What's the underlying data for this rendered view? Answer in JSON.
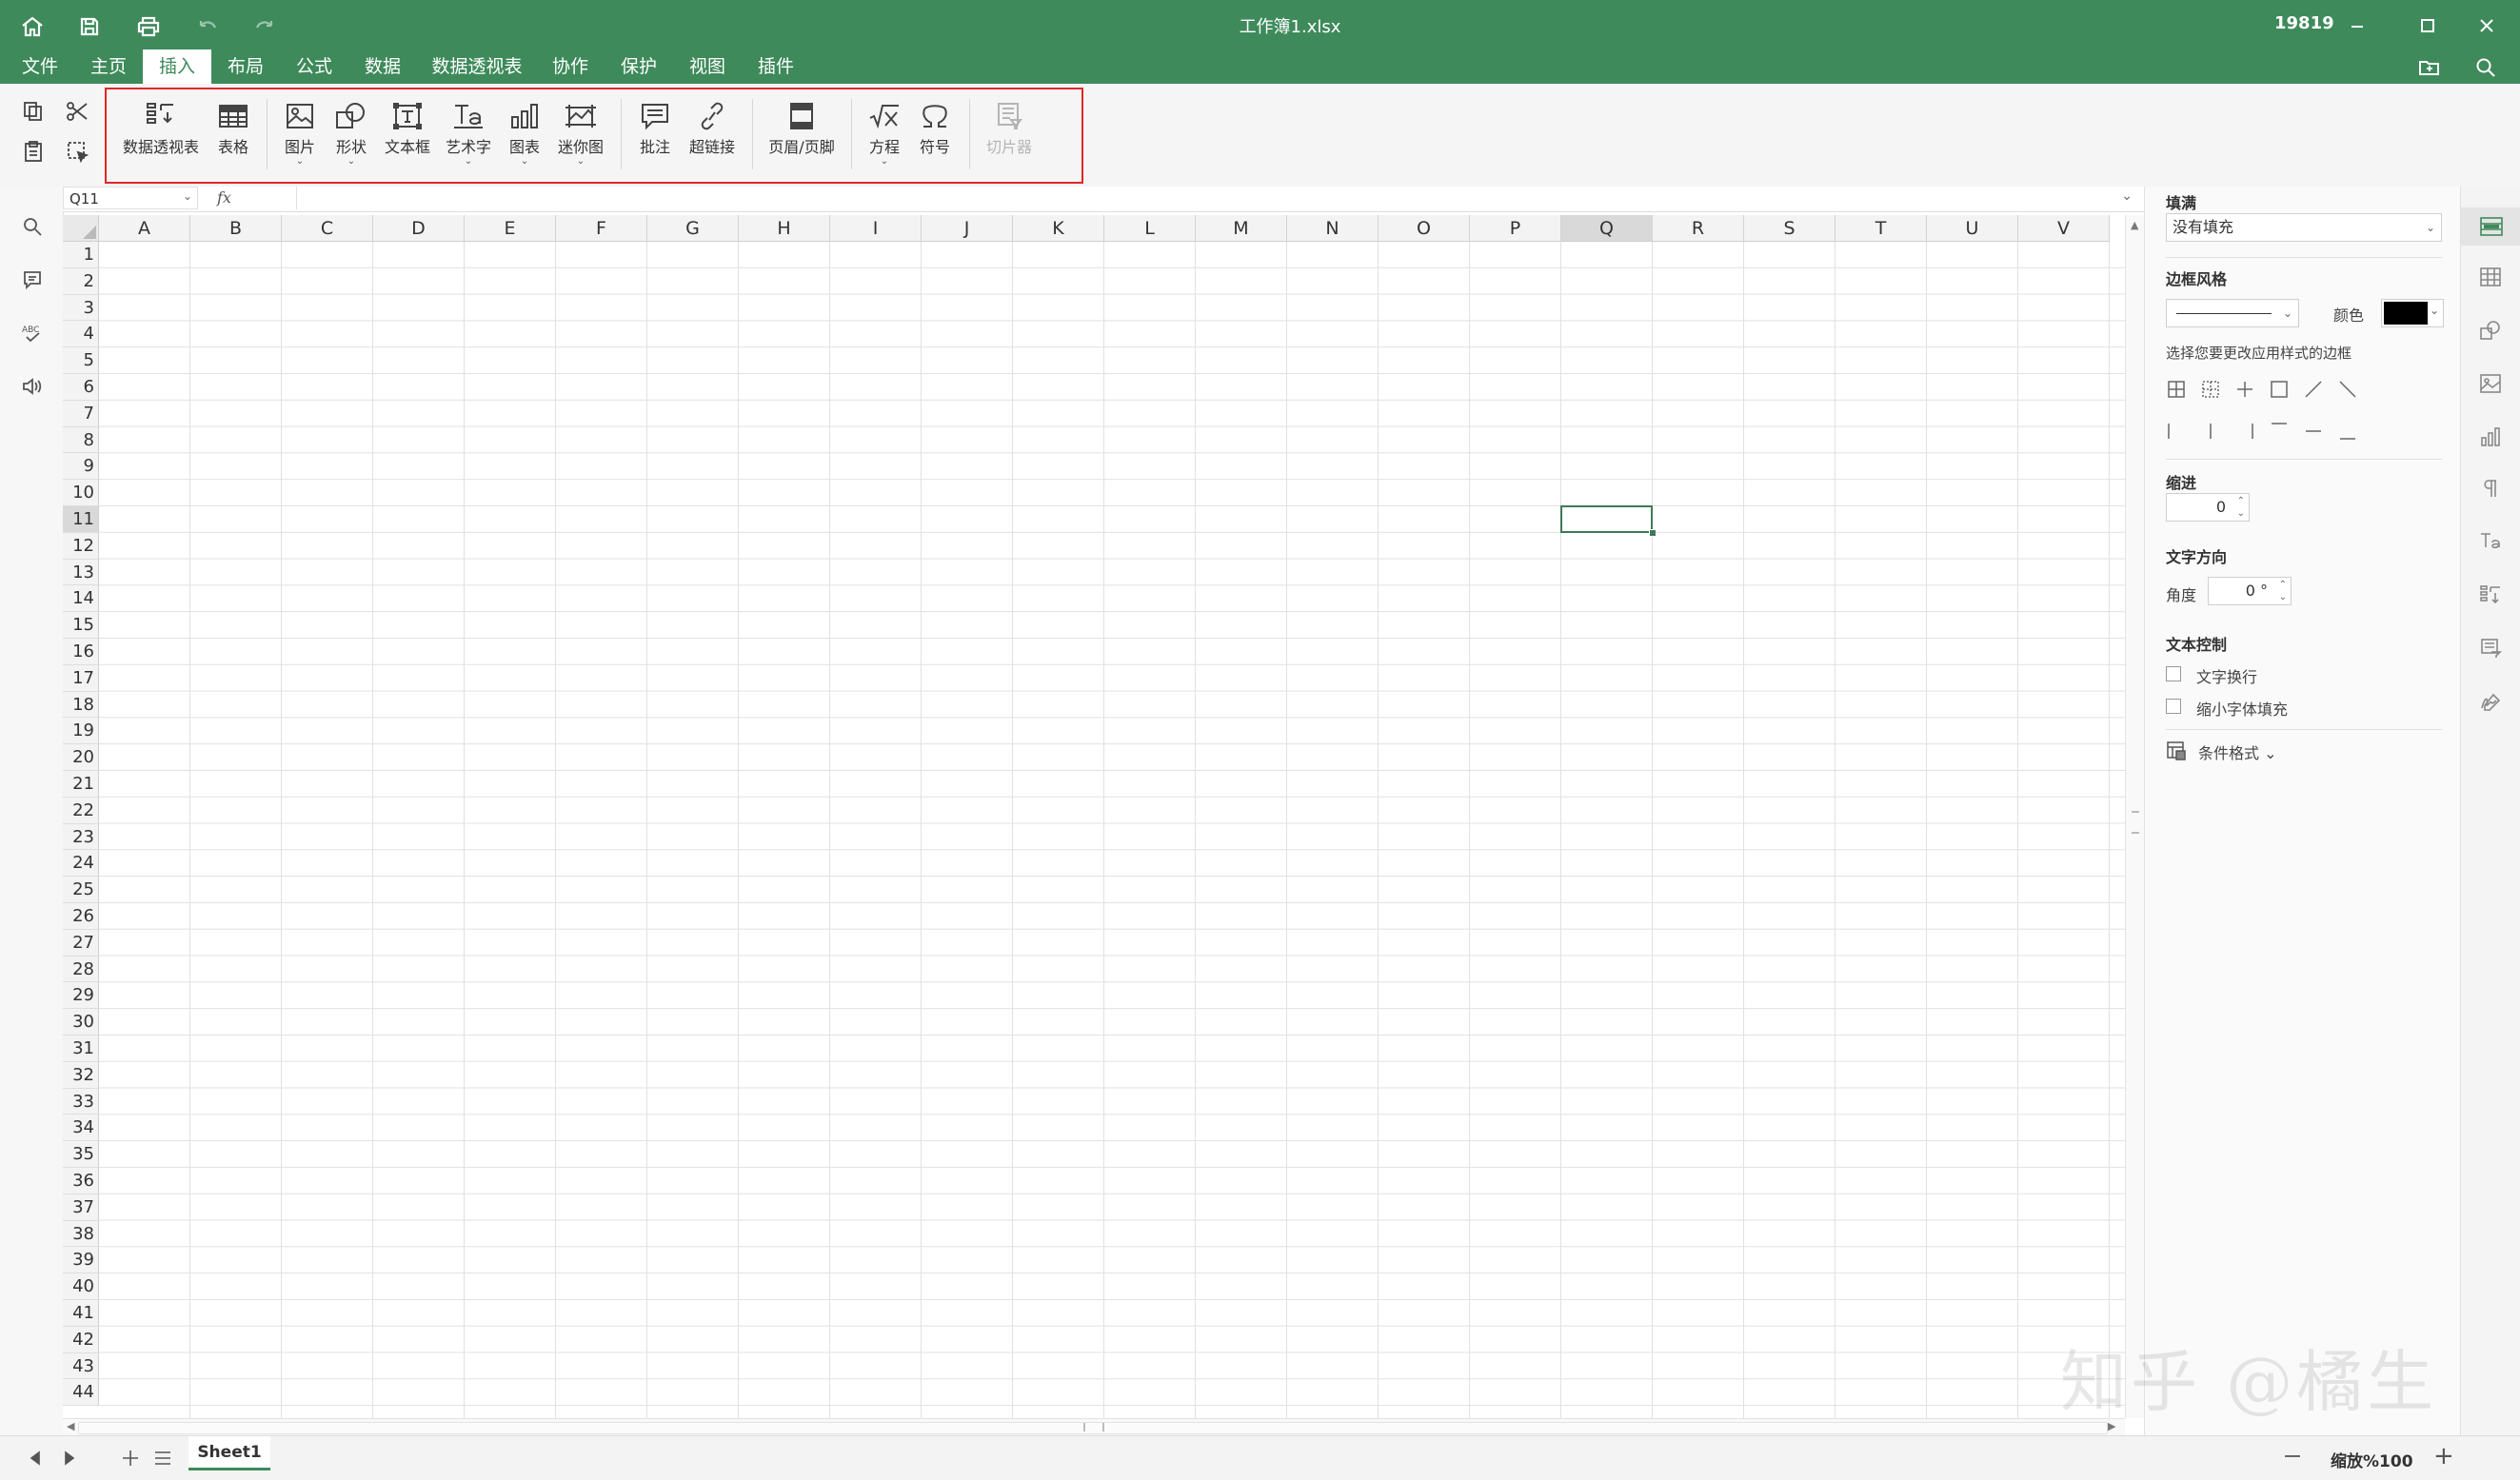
{
  "window": {
    "title": "工作簿1.xlsx",
    "user_id": "19819"
  },
  "menu": {
    "tabs": [
      "文件",
      "主页",
      "插入",
      "布局",
      "公式",
      "数据",
      "数据透视表",
      "协作",
      "保护",
      "视图",
      "插件"
    ],
    "active": "插入"
  },
  "ribbon": {
    "buttons": [
      {
        "label": "数据透视表",
        "icon": "pivot-table-icon",
        "caret": false,
        "disabled": false
      },
      {
        "label": "表格",
        "icon": "table-icon",
        "caret": false,
        "disabled": false
      },
      {
        "label": "图片",
        "icon": "image-icon",
        "caret": true,
        "disabled": false
      },
      {
        "label": "形状",
        "icon": "shape-icon",
        "caret": true,
        "disabled": false
      },
      {
        "label": "文本框",
        "icon": "text-box-icon",
        "caret": false,
        "disabled": false
      },
      {
        "label": "艺术字",
        "icon": "text-art-icon",
        "caret": true,
        "disabled": false
      },
      {
        "label": "图表",
        "icon": "chart-icon",
        "caret": true,
        "disabled": false
      },
      {
        "label": "迷你图",
        "icon": "sparkline-icon",
        "caret": true,
        "disabled": false
      },
      {
        "label": "批注",
        "icon": "comment-icon",
        "caret": false,
        "disabled": false
      },
      {
        "label": "超链接",
        "icon": "hyperlink-icon",
        "caret": false,
        "disabled": false
      },
      {
        "label": "页眉/页脚",
        "icon": "header-footer-icon",
        "caret": false,
        "disabled": false
      },
      {
        "label": "方程",
        "icon": "equation-icon",
        "caret": true,
        "disabled": false
      },
      {
        "label": "符号",
        "icon": "omega-symbol-icon",
        "caret": false,
        "disabled": false
      },
      {
        "label": "切片器",
        "icon": "slicer-icon",
        "caret": false,
        "disabled": true
      }
    ]
  },
  "formula_bar": {
    "name_box": "Q11",
    "fx": "fx",
    "value": ""
  },
  "grid": {
    "columns": [
      "A",
      "B",
      "C",
      "D",
      "E",
      "F",
      "G",
      "H",
      "I",
      "J",
      "K",
      "L",
      "M",
      "N",
      "O",
      "P",
      "Q",
      "R",
      "S",
      "T",
      "U",
      "V"
    ],
    "rows": [
      "1",
      "2",
      "3",
      "4",
      "5",
      "6",
      "7",
      "8",
      "9",
      "10",
      "11",
      "12",
      "13",
      "14",
      "15",
      "16",
      "17",
      "18",
      "19",
      "20",
      "21",
      "22",
      "23",
      "24",
      "25",
      "26",
      "27",
      "28",
      "29",
      "30",
      "31",
      "32",
      "33",
      "34",
      "35",
      "36",
      "37",
      "38",
      "39",
      "40",
      "41",
      "42",
      "43",
      "44"
    ],
    "active_cell": "Q11",
    "active_column": "Q",
    "active_row": "11"
  },
  "format_panel": {
    "fill_title": "填满",
    "fill_value": "没有填充",
    "border_style_title": "边框风格",
    "color_label": "颜色",
    "border_color": "#000000",
    "border_hint": "选择您要更改应用样式的边框",
    "indent_title": "缩进",
    "indent_value": "0",
    "text_direction_title": "文字方向",
    "angle_label": "角度",
    "angle_value": "0 °",
    "text_control_title": "文本控制",
    "wrap_text_label": "文字换行",
    "shrink_to_fit_label": "缩小字体填充",
    "wrap_text_checked": false,
    "shrink_to_fit_checked": false,
    "conditional_format_label": "条件格式 ⌄"
  },
  "status_bar": {
    "sheet_name": "Sheet1",
    "zoom_label": "缩放%100"
  },
  "watermark": "知乎 @橘生",
  "colors": {
    "accent": "#3e8a5b",
    "highlight_box": "#e02727"
  }
}
